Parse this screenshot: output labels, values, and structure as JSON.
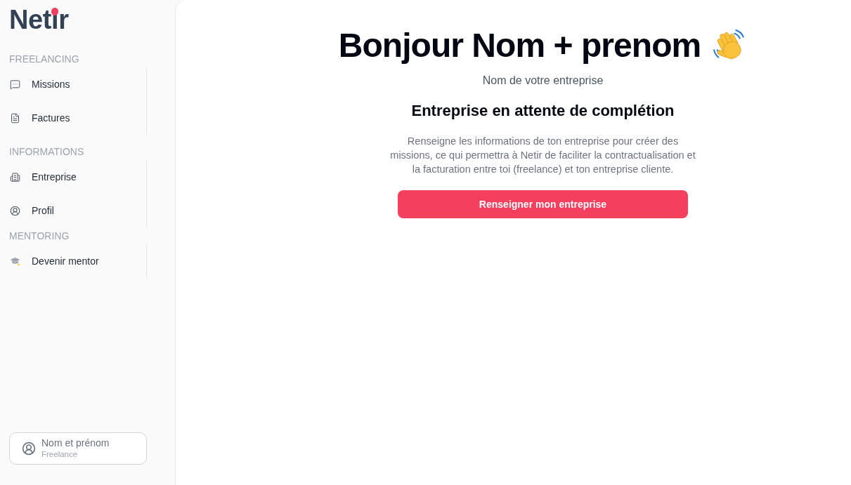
{
  "sidebar": {
    "logo": "Netir",
    "sections": [
      {
        "title": "FREELANCING",
        "items": [
          {
            "label": "Missions",
            "selected": false
          },
          {
            "label": "Factures",
            "selected": false
          }
        ]
      },
      {
        "title": "INFORMATIONS",
        "items": [
          {
            "label": "Entreprise",
            "selected": false
          },
          {
            "label": "Profil",
            "selected": false
          }
        ]
      },
      {
        "title": "MENTORING",
        "items": [
          {
            "label": "Devenir mentor",
            "selected": false
          }
        ]
      }
    ],
    "user": {
      "name": "Nom et prénom",
      "role": "Freelance"
    }
  },
  "main": {
    "greeting": "Bonjour Nom + prenom",
    "company": "Nom de votre entreprise",
    "status_heading": "Entreprise en attente de complétion",
    "description": "Renseigne les informations de ton entreprise pour créer des missions, ce qui permettra à Netir de faciliter la contractualisation et la facturation entre toi (freelance) et ton entreprise cliente.",
    "button": "Renseigner mon entreprise"
  }
}
